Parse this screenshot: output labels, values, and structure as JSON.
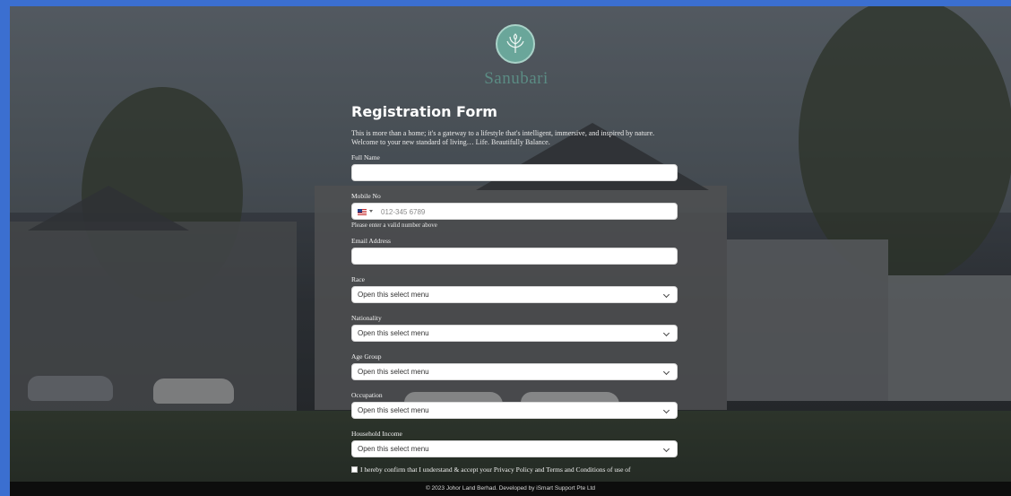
{
  "brand": {
    "name": "Sanubari",
    "logo_icon": "flower-emblem-icon"
  },
  "form": {
    "title": "Registration Form",
    "intro": "This is more than a home; it's a gateway to a lifestyle that's intelligent, immersive, and inspired by nature. Welcome to your new standard of living… Life. Beautifully Balance.",
    "full_name": {
      "label": "Full Name",
      "value": ""
    },
    "mobile": {
      "label": "Mobile No",
      "placeholder": "012-345 6789",
      "flag_icon": "us-flag-icon",
      "hint": "Please enter a valid number above"
    },
    "email": {
      "label": "Email Address",
      "value": ""
    },
    "race": {
      "label": "Race",
      "selected": "Open this select menu"
    },
    "nationality": {
      "label": "Nationality",
      "selected": "Open this select menu"
    },
    "age_group": {
      "label": "Age Group",
      "selected": "Open this select menu"
    },
    "occupation": {
      "label": "Occupation",
      "selected": "Open this select menu"
    },
    "household_income": {
      "label": "Household Income",
      "selected": "Open this select menu"
    },
    "consent": "I hereby confirm that I understand & accept your Privacy Policy and Terms and Conditions of use of"
  },
  "footer": {
    "text": "© 2023 Johor Land Berhad. Developed by iSmart Support Pte Ltd"
  },
  "colors": {
    "frame": "#3b6fd0",
    "brand": "#5b8c84",
    "footer_bg": "#0d0d0d"
  }
}
